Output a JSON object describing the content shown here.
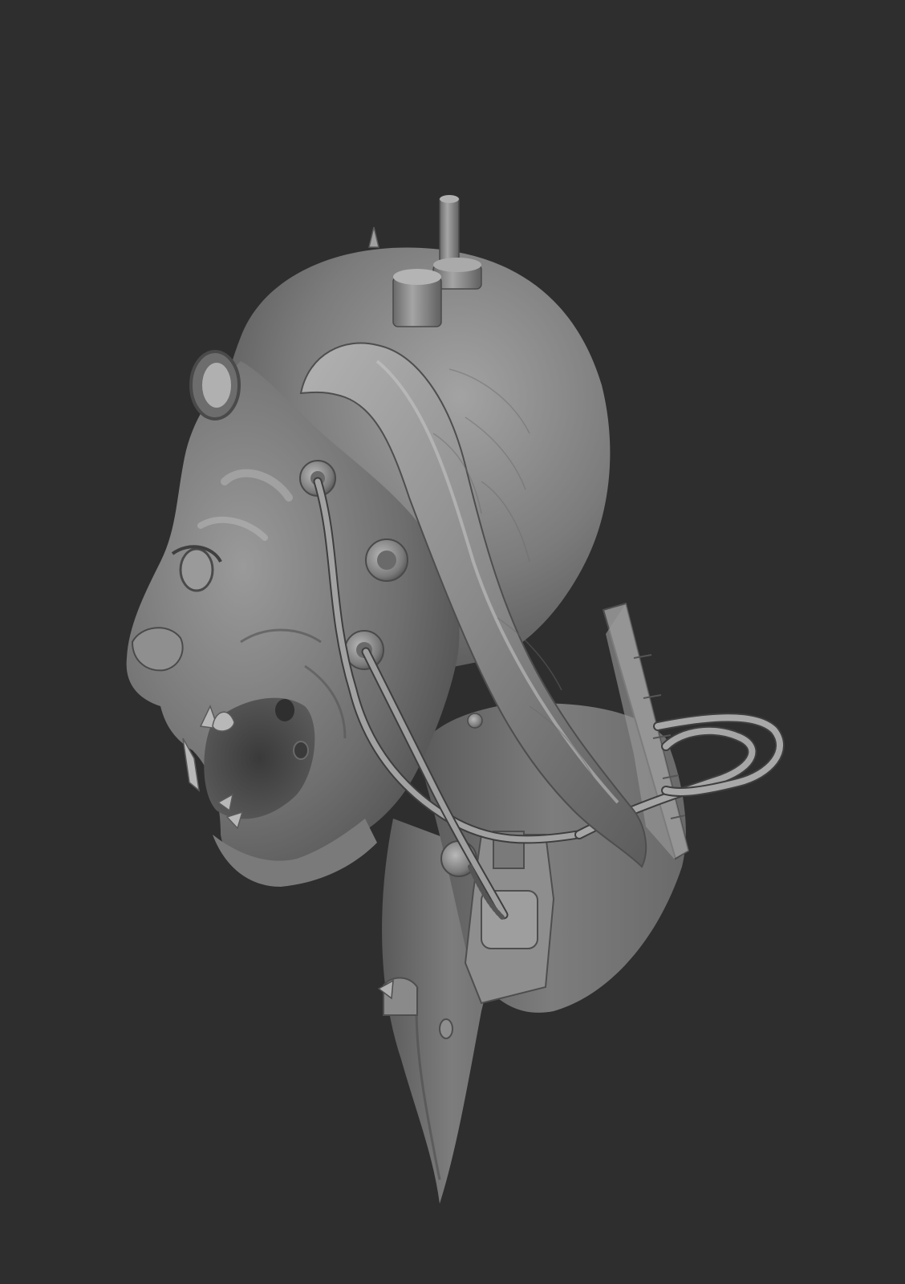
{
  "scene": {
    "subject": "sculpt-render",
    "background_color": "#2e2e2e",
    "clay_color": "#8a8a8a",
    "shadow_color": "#3f3f3f",
    "highlight_color": "#c4c4c4"
  }
}
